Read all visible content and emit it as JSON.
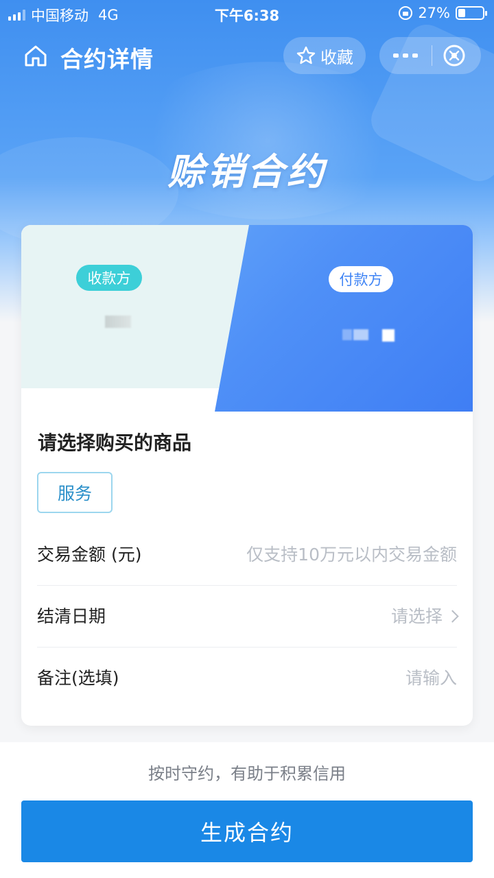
{
  "status_bar": {
    "carrier": "中国移动",
    "network": "4G",
    "time": "下午6:38",
    "battery_percent": "27%"
  },
  "navbar": {
    "title": "合约详情",
    "favorite_label": "收藏",
    "home_icon": "home-icon",
    "more_icon": "more-icon",
    "close_icon": "close-icon"
  },
  "hero": {
    "title": "赊销合约"
  },
  "parties": {
    "payee_tag": "收款方",
    "payer_tag": "付款方"
  },
  "form": {
    "section_title": "请选择购买的商品",
    "product_option": "服务",
    "amount_label": "交易金额 (元)",
    "amount_placeholder": "仅支持10万元以内交易金额",
    "date_label": "结清日期",
    "date_placeholder": "请选择",
    "note_label": "备注(选填)",
    "note_placeholder": "请输入"
  },
  "footer": {
    "hint": "按时守约，有助于积累信用",
    "submit_label": "生成合约"
  },
  "colors": {
    "primary_blue": "#1a88e6",
    "payee_tag": "#3dcfd8",
    "payer_panel": "#4f90f7",
    "service_border": "#9cd6ee"
  }
}
